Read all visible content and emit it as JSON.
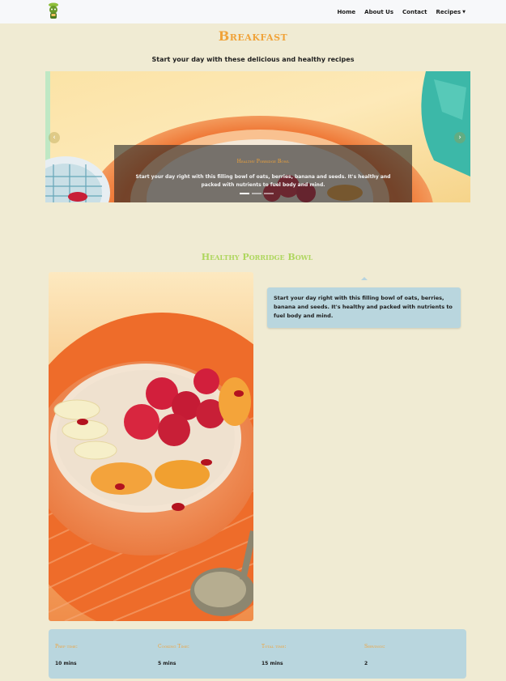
{
  "navbar": {
    "logo_icon": "chef-mascot-logo",
    "links": [
      {
        "label": "Home"
      },
      {
        "label": "About Us"
      },
      {
        "label": "Contact"
      },
      {
        "label": "Recipes"
      }
    ]
  },
  "page": {
    "title": "Breakfast",
    "subtitle": "Start your day with these delicious and healthy recipes"
  },
  "carousel": {
    "prev_icon": "chevron-left-icon",
    "next_icon": "chevron-right-icon",
    "caption_title": "Healthy Porridge Bowl",
    "caption_text": "Start your day right with this filling bowl of oats, berries, banana and seeds. It's healthy and packed with nutrients to fuel body and mind.",
    "indicator_count": 3,
    "active_indicator": 1
  },
  "recipe": {
    "title": "Healthy Porridge Bowl",
    "description": "Start your day right with this filling bowl of oats, berries, banana and seeds. It's healthy and packed with nutrients to fuel body and mind.",
    "info": [
      {
        "label": "Prep time:",
        "value": "10 mins"
      },
      {
        "label": "Cooking Time:",
        "value": "5 mins"
      },
      {
        "label": "Total time:",
        "value": "15 mins"
      },
      {
        "label": "Servings:",
        "value": "2"
      }
    ]
  },
  "colors": {
    "background": "#f0ebd3",
    "accent_orange": "#f0a33a",
    "accent_green": "#aed65e",
    "panel_blue": "#b9d6de"
  }
}
